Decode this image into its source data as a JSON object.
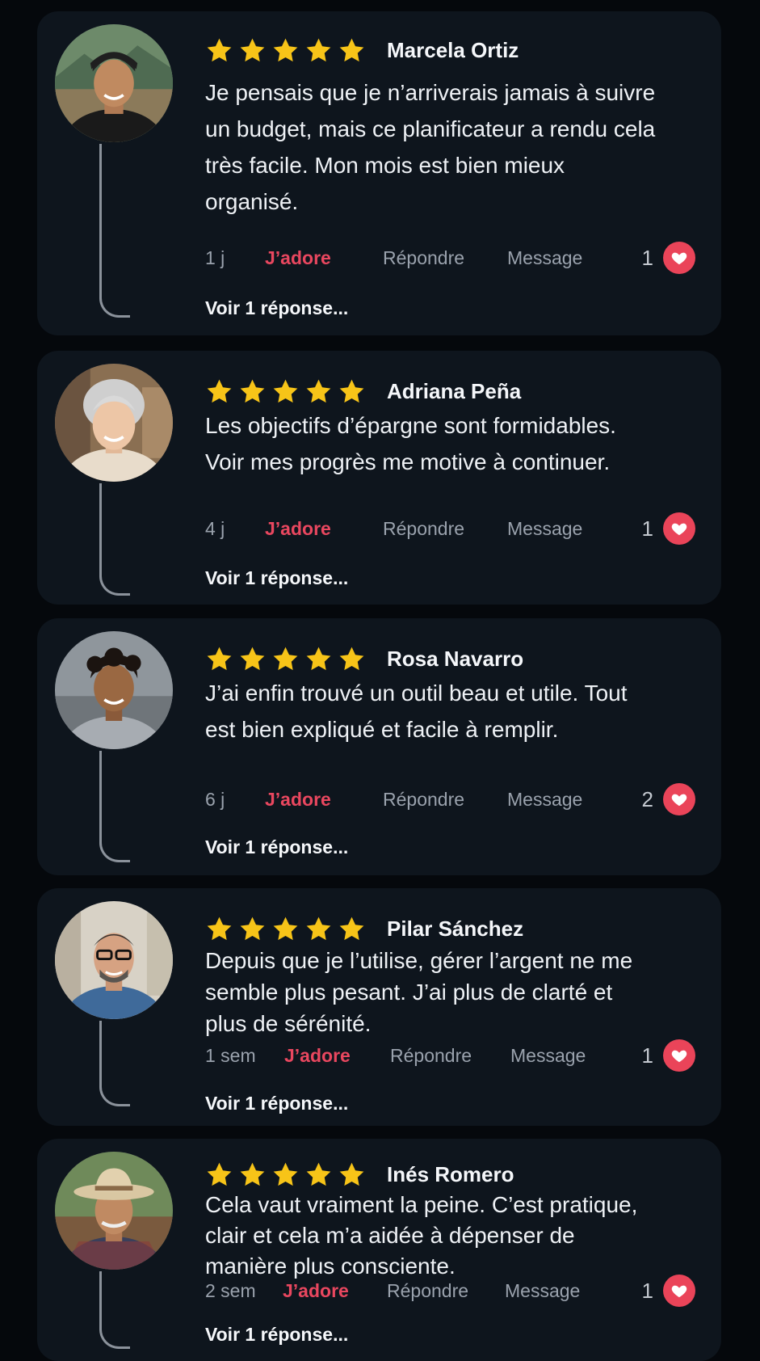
{
  "colors": {
    "background": "#05080c",
    "card": "#0e151d",
    "star": "#f7c418",
    "love_label": "#e9475f",
    "heart_badge": "#ea4459",
    "muted_text": "#9aa2ad",
    "thread_line": "#8b929b"
  },
  "icons": {
    "star": "star-icon",
    "heart": "heart-icon",
    "avatar": "avatar-photo"
  },
  "reviews": [
    {
      "name": "Marcela Ortiz",
      "rating": 5,
      "text": "Je pensais que je n’arriverais jamais à suivre un budget, mais ce planificateur a rendu cela très facile. Mon mois est bien mieux organisé.",
      "time": "1 j",
      "love_label": "J’adore",
      "reply_label": "Répondre",
      "message_label": "Message",
      "likes": "1",
      "replies_label": "Voir 1 réponse..."
    },
    {
      "name": "Adriana Peña",
      "rating": 5,
      "text": "Les objectifs d’épargne sont formidables. Voir mes progrès me motive à continuer.",
      "time": "4 j",
      "love_label": "J’adore",
      "reply_label": "Répondre",
      "message_label": "Message",
      "likes": "1",
      "replies_label": "Voir 1 réponse..."
    },
    {
      "name": "Rosa Navarro",
      "rating": 5,
      "text": "J’ai enfin trouvé un outil beau et utile. Tout est bien expliqué et facile à remplir.",
      "time": "6 j",
      "love_label": "J’adore",
      "reply_label": "Répondre",
      "message_label": "Message",
      "likes": "2",
      "replies_label": "Voir 1 réponse..."
    },
    {
      "name": "Pilar Sánchez",
      "rating": 5,
      "text": "Depuis que je l’utilise, gérer l’argent ne me semble plus pesant. J’ai plus de clarté et plus de sérénité.",
      "time": "1 sem",
      "love_label": "J’adore",
      "reply_label": "Répondre",
      "message_label": "Message",
      "likes": "1",
      "replies_label": "Voir 1 réponse..."
    },
    {
      "name": "Inés Romero",
      "rating": 5,
      "text": "Cela vaut vraiment la peine. C’est pratique, clair et cela m’a aidée à dépenser de manière plus consciente.",
      "time": "2 sem",
      "love_label": "J’adore",
      "reply_label": "Répondre",
      "message_label": "Message",
      "likes": "1",
      "replies_label": "Voir 1 réponse..."
    }
  ]
}
